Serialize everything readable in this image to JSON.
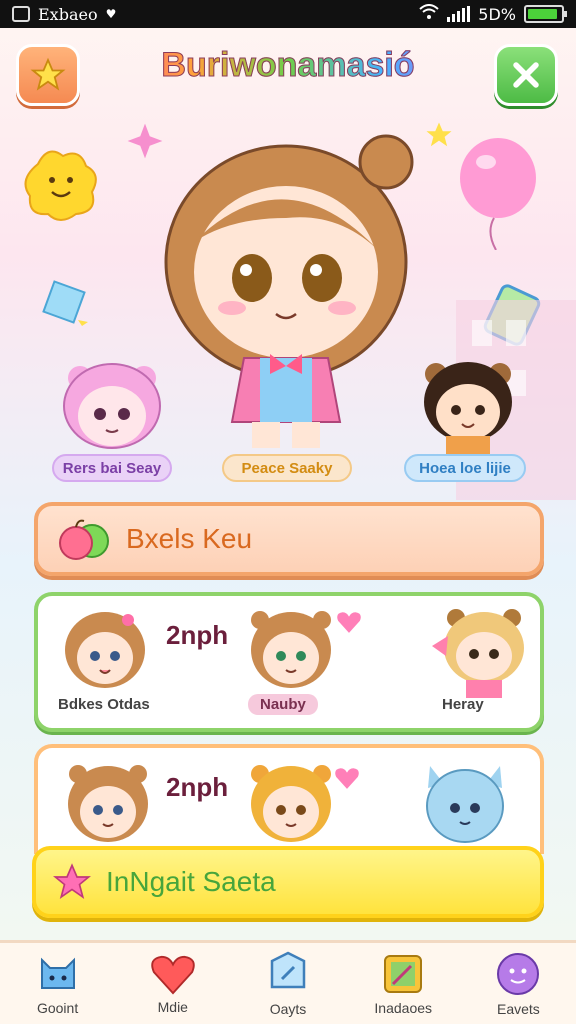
{
  "status_bar": {
    "app_name": "Exbaeo",
    "battery": "5D%",
    "battery_level": 0.9
  },
  "header": {
    "title": "Buriwonamasió"
  },
  "characters": [
    {
      "label": "Rers bai Seay"
    },
    {
      "label": "Peace Saaky"
    },
    {
      "label": "Hoea loe lijie"
    }
  ],
  "menu_bar": {
    "title": "Bxels Keu"
  },
  "panel_1": {
    "score": "2nph",
    "players": [
      {
        "name": "Bdkes Otdas"
      },
      {
        "name": "Nauby"
      },
      {
        "name": "Heray"
      }
    ]
  },
  "panel_2": {
    "score": "2nph"
  },
  "yellow_bar": {
    "title": "InNgait Saeta"
  },
  "bottom_nav": [
    {
      "label": "Gooint",
      "icon": "cat-icon"
    },
    {
      "label": "Mdie",
      "icon": "heart-icon"
    },
    {
      "label": "Oayts",
      "icon": "shield-icon"
    },
    {
      "label": "Inadaoes",
      "icon": "book-icon"
    },
    {
      "label": "Eavets",
      "icon": "face-icon"
    }
  ],
  "colors": {
    "orange_button": "#f58a52",
    "green_button": "#4dbb45",
    "panel_green": "#8ed36a",
    "panel_orange": "#f4a56b",
    "yellow_bar": "#ffe33d"
  }
}
